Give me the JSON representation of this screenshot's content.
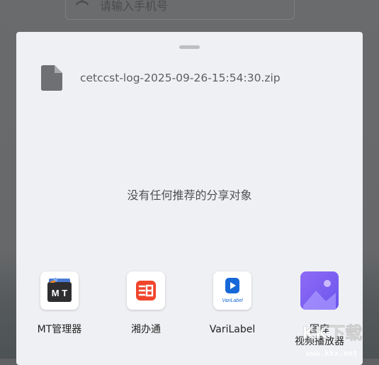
{
  "background": {
    "phone_placeholder": "请输入手机号"
  },
  "share_sheet": {
    "file_name": "cetccst-log-2025-09-26-15:54:30.zip",
    "empty_message": "没有任何推荐的分享对象",
    "apps": [
      {
        "label": "MT管理器",
        "icon": "mt-manager-icon"
      },
      {
        "label": "湘办通",
        "icon": "xiangbantong-icon"
      },
      {
        "label": "VariLabel",
        "icon": "varilabel-icon",
        "icon_text": "VariLabel"
      },
      {
        "label": "图库",
        "label2": "视频播放器",
        "icon": "gallery-icon"
      }
    ]
  },
  "watermark": {
    "text": "KK下载",
    "url": "www.kkx.net"
  },
  "colors": {
    "sheet_bg": "#eff0f3",
    "xiangbantong_red": "#f0452c",
    "varilabel_blue": "#1668d8",
    "gallery_purple": "#7b5cf0"
  }
}
